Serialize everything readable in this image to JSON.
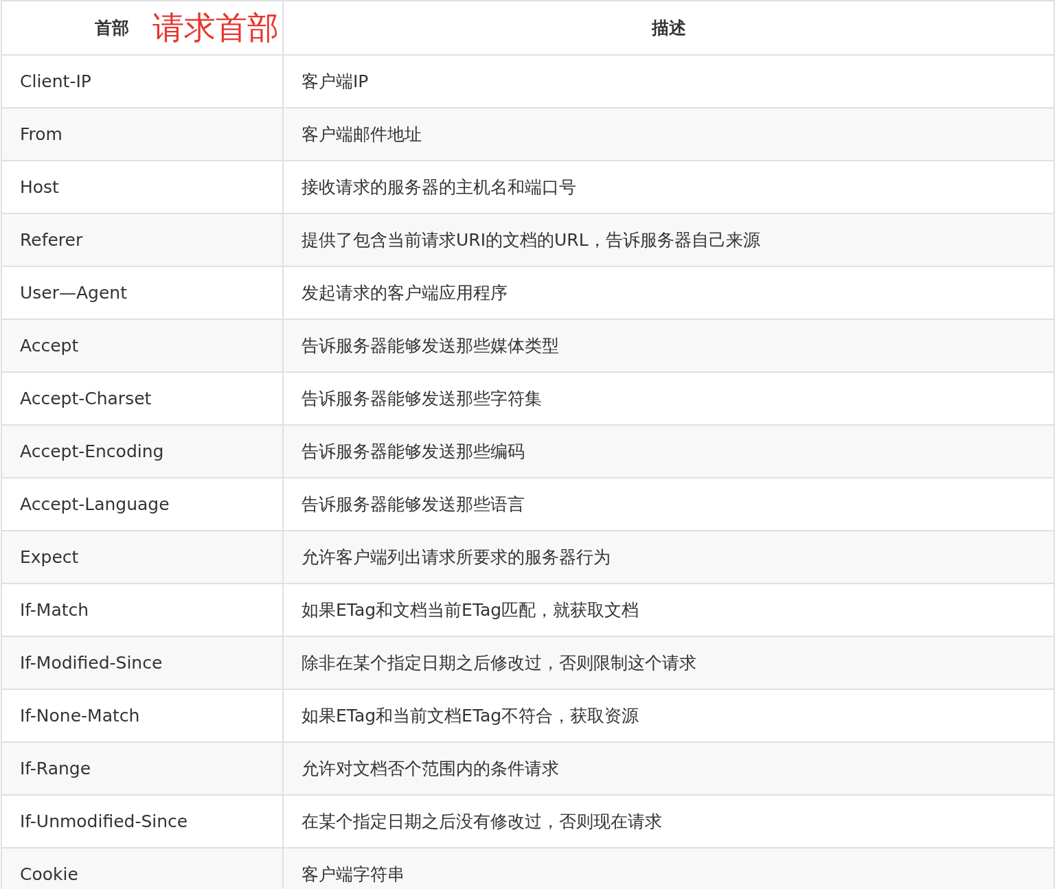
{
  "table": {
    "columns": [
      {
        "label": "首部",
        "annotation": "请求首部"
      },
      {
        "label": "描述"
      }
    ],
    "rows": [
      [
        "Client-IP",
        "客户端IP"
      ],
      [
        "From",
        "客户端邮件地址"
      ],
      [
        "Host",
        "接收请求的服务器的主机名和端口号"
      ],
      [
        "Referer",
        "提供了包含当前请求URI的文档的URL，告诉服务器自己来源"
      ],
      [
        "User—Agent",
        "发起请求的客户端应用程序"
      ],
      [
        "Accept",
        "告诉服务器能够发送那些媒体类型"
      ],
      [
        "Accept-Charset",
        "告诉服务器能够发送那些字符集"
      ],
      [
        "Accept-Encoding",
        "告诉服务器能够发送那些编码"
      ],
      [
        "Accept-Language",
        "告诉服务器能够发送那些语言"
      ],
      [
        "Expect",
        "允许客户端列出请求所要求的服务器行为"
      ],
      [
        "If-Match",
        "如果ETag和文档当前ETag匹配，就获取文档"
      ],
      [
        "If-Modified-Since",
        "除非在某个指定日期之后修改过，否则限制这个请求"
      ],
      [
        "If-None-Match",
        "如果ETag和当前文档ETag不符合，获取资源"
      ],
      [
        "If-Range",
        "允许对文档否个范围内的条件请求"
      ],
      [
        "If-Unmodified-Since",
        "在某个指定日期之后没有修改过，否则现在请求"
      ],
      [
        "Cookie",
        "客户端字符串"
      ]
    ]
  }
}
